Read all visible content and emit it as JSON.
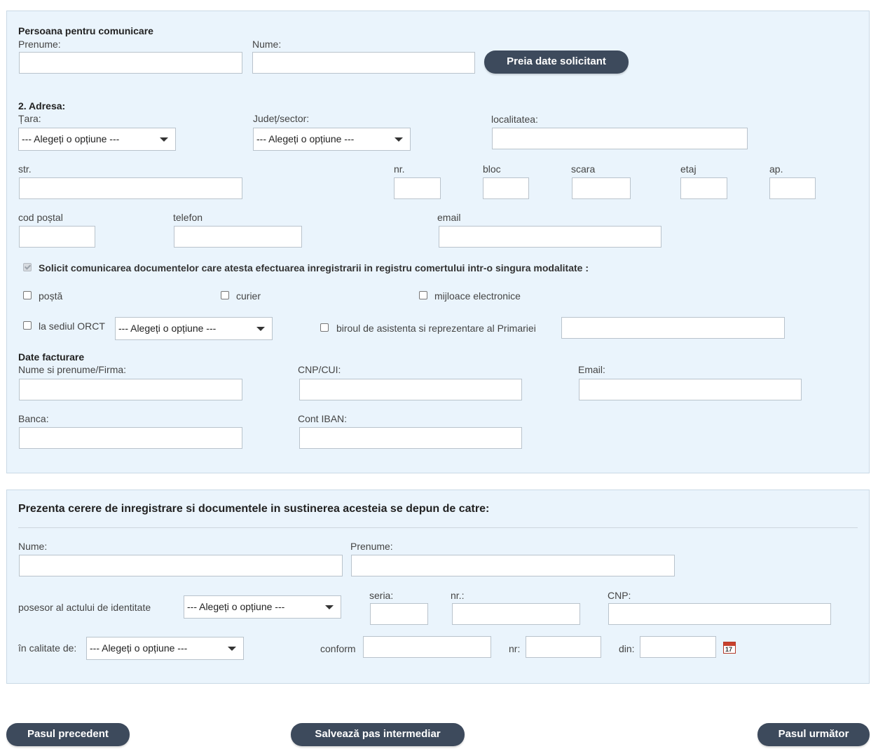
{
  "contact": {
    "section_title": "Persoana pentru comunicare",
    "prenume_label": "Prenume:",
    "nume_label": "Nume:",
    "preia_button": "Preia date solicitant"
  },
  "address": {
    "section_title": "2. Adresa:",
    "tara_label": "Țara:",
    "tara_select": "--- Alegeți o opțiune ---",
    "judet_label": "Județ/sector:",
    "judet_select": "--- Alegeți o opțiune ---",
    "localitate_label": "localitatea:",
    "str_label": "str.",
    "nr_label": "nr.",
    "bloc_label": "bloc",
    "scara_label": "scara",
    "etaj_label": "etaj",
    "ap_label": "ap.",
    "cod_postal_label": "cod poștal",
    "telefon_label": "telefon",
    "email_label": "email"
  },
  "communication": {
    "main_label": "Solicit comunicarea documentelor care atesta efectuarea inregistrarii in registru comertului intr-o singura modalitate :",
    "main_checked": true,
    "posta_label": "poștă",
    "curier_label": "curier",
    "electronice_label": "mijloace electronice",
    "sediu_label": "la sediul ORCT",
    "sediu_select": "--- Alegeți o opțiune ---",
    "birou_label": "biroul de asistenta si reprezentare al Primariei"
  },
  "billing": {
    "section_title": "Date facturare",
    "nume_label": "Nume si prenume/Firma:",
    "cnp_label": "CNP/CUI:",
    "email_label": "Email:",
    "banca_label": "Banca:",
    "iban_label": "Cont IBAN:"
  },
  "submitter": {
    "title": "Prezenta cerere de inregistrare si documentele in sustinerea acesteia se depun de catre:",
    "nume_label": "Nume:",
    "prenume_label": "Prenume:",
    "posesor_label": "posesor al actului de identitate",
    "act_select": "--- Alegeți o opțiune ---",
    "seria_label": "seria:",
    "nr_label": "nr.:",
    "cnp_label": "CNP:",
    "calitate_label": "în calitate de:",
    "calitate_select": "--- Alegeți o opțiune ---",
    "conform_label": "conform",
    "nr2_label": "nr:",
    "din_label": "din:",
    "calendar_day": "17"
  },
  "footer": {
    "prev_button": "Pasul precedent",
    "save_button": "Salvează pas intermediar",
    "next_button": "Pasul următor"
  }
}
